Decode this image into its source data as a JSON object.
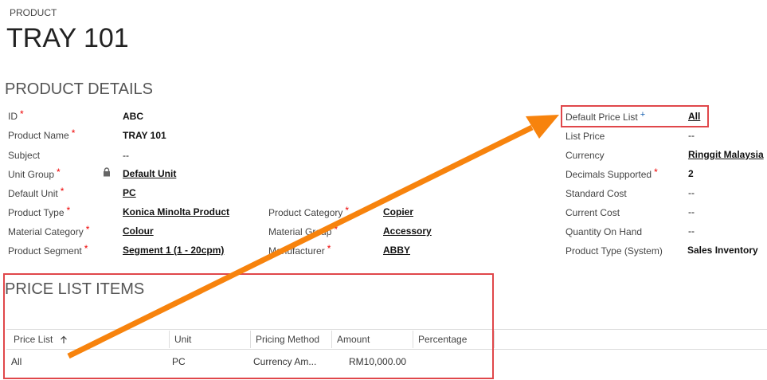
{
  "header": {
    "entity_type": "PRODUCT",
    "title": "TRAY 101"
  },
  "details": {
    "section_title": "PRODUCT DETAILS",
    "col1": [
      {
        "label": "ID",
        "required": true,
        "value": "ABC",
        "link": false
      },
      {
        "label": "Product Name",
        "required": true,
        "value": "TRAY 101",
        "link": false
      },
      {
        "label": "Subject",
        "required": false,
        "value": "--",
        "link": false
      },
      {
        "label": "Unit Group",
        "required": true,
        "value": "Default Unit",
        "link": true,
        "locked": true
      },
      {
        "label": "Default Unit",
        "required": true,
        "value": "PC",
        "link": true
      },
      {
        "label": "Product Type",
        "required": true,
        "value": "Konica Minolta Product",
        "link": true
      },
      {
        "label": "Material Category",
        "required": true,
        "value": "Colour",
        "link": true
      },
      {
        "label": "Product Segment",
        "required": true,
        "value": "Segment 1 (1 - 20cpm)",
        "link": true
      }
    ],
    "col2": [
      {
        "label": "Product Category",
        "required": true,
        "value": "Copier",
        "link": true
      },
      {
        "label": "Material Group",
        "required": true,
        "value": "Accessory",
        "link": true
      },
      {
        "label": "Manufacturer",
        "required": true,
        "value": "ABBY",
        "link": true
      }
    ],
    "col3": [
      {
        "label": "Default Price List",
        "recommended": true,
        "value": "All",
        "link": true
      },
      {
        "label": "List Price",
        "value": "--",
        "link": false
      },
      {
        "label": "Currency",
        "value": "Ringgit Malaysia",
        "link": true
      },
      {
        "label": "Decimals Supported",
        "required": true,
        "value": "2",
        "link": false
      },
      {
        "label": "Standard Cost",
        "value": "--",
        "link": false
      },
      {
        "label": "Current Cost",
        "value": "--",
        "link": false
      },
      {
        "label": "Quantity On Hand",
        "value": "--",
        "link": false
      },
      {
        "label": "Product Type (System)",
        "value": "Sales Inventory",
        "link": false
      }
    ]
  },
  "price_list": {
    "section_title": "PRICE LIST ITEMS",
    "columns": [
      "Price List",
      "Unit",
      "Pricing Method",
      "Amount",
      "Percentage"
    ],
    "sort_column": "Price List",
    "rows": [
      {
        "price_list": "All",
        "unit": "PC",
        "pricing_method": "Currency Am...",
        "amount": "RM10,000.00",
        "percentage": ""
      }
    ]
  },
  "annotation": {
    "box_color": "#e0474a",
    "arrow_color": "#f7830d"
  }
}
